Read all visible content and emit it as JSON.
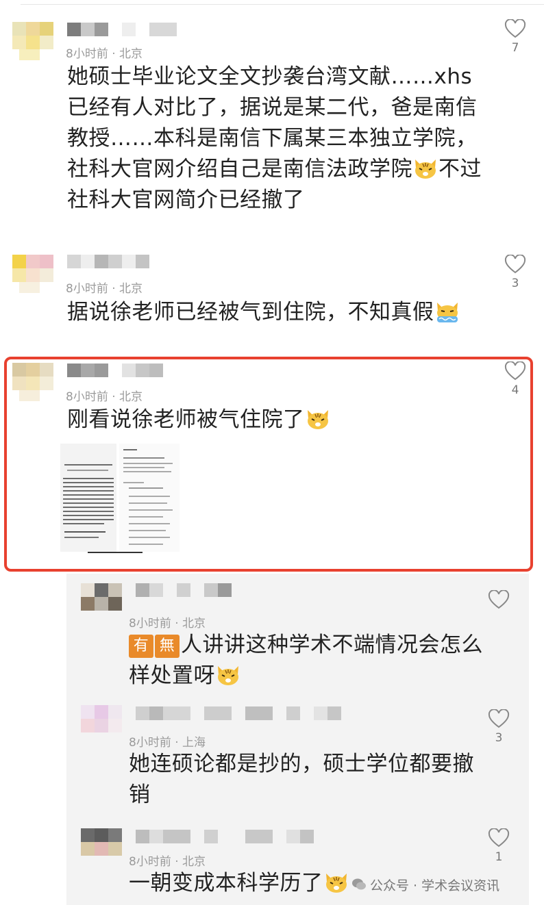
{
  "comments": [
    {
      "meta": "8小时前 · 北京",
      "text_parts": [
        "她硕士毕业论文全文抄袭台湾文献……xhs",
        "已经有人对比了，据说是某二代，爸是南信",
        "教授……本科是南信下属某三本独立学院，",
        "社科大官网介绍自己是南信法政学院",
        "不过",
        "社科大官网简介已经撤了"
      ],
      "likes": "7",
      "emoji": "cat-face-icon"
    },
    {
      "meta": "8小时前 · 北京",
      "text": "据说徐老师已经被气到住院，不知真假",
      "likes": "3",
      "emoji": "cat-crying-icon"
    },
    {
      "meta": "8小时前 · 北京",
      "text": "刚看说徐老师被气住院了",
      "likes": "4",
      "emoji": "cat-face-icon",
      "highlighted": true
    }
  ],
  "replies": [
    {
      "meta": "8小时前 · 北京",
      "tag1": "有",
      "tag2": "無",
      "text_line1": "人讲讲这种学术不端情况会怎么",
      "text_line2": "样处置呀",
      "likes": "",
      "emoji": "cat-face-icon"
    },
    {
      "meta": "8小时前 · 上海",
      "text_line1": "她连硕论都是抄的，硕士学位都要撤",
      "text_line2": "销",
      "likes": "3"
    },
    {
      "meta": "8小时前 · 北京",
      "text_line1": "一朝变成本科学历了",
      "likes": "1",
      "emoji": "cat-face-icon"
    }
  ],
  "watermark": "公众号 · 学术会议资讯",
  "colors": {
    "highlight": "#e8412f",
    "reply_bg": "#f3f3f3"
  }
}
